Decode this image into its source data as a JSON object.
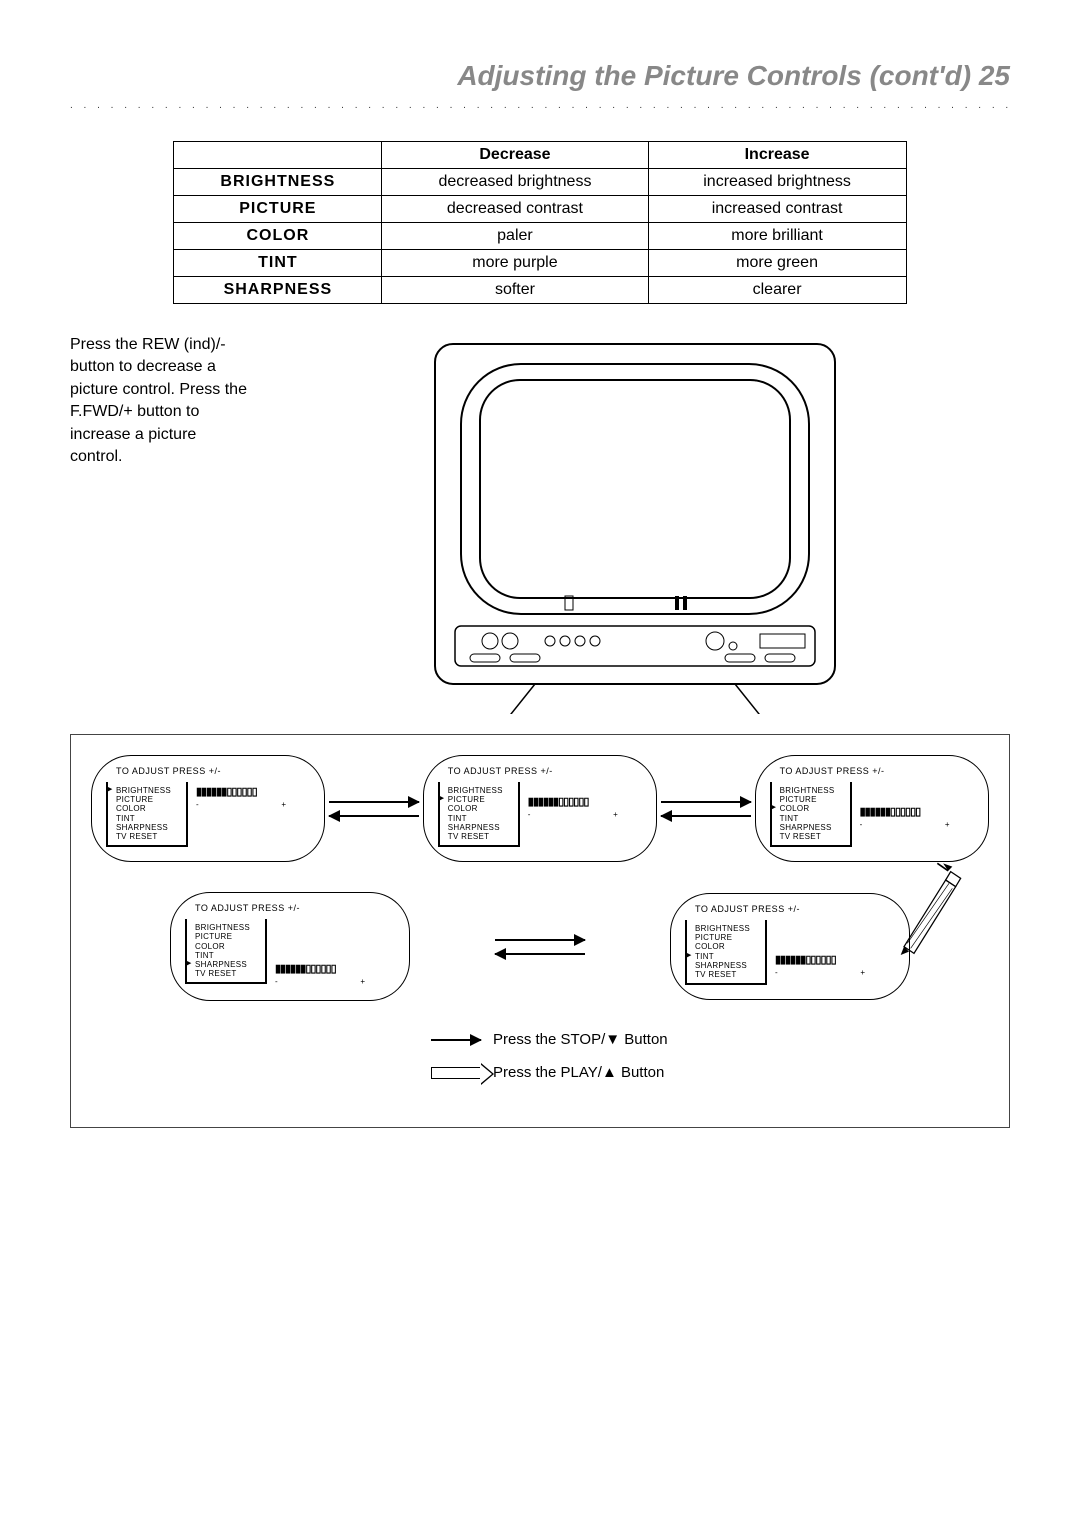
{
  "page": {
    "title": "Adjusting the Picture Controls (cont'd)  25"
  },
  "table": {
    "headers": {
      "col1": "",
      "col2": "Decrease",
      "col3": "Increase"
    },
    "rows": [
      {
        "label": "BRIGHTNESS",
        "dec": "decreased brightness",
        "inc": "increased brightness"
      },
      {
        "label": "PICTURE",
        "dec": "decreased contrast",
        "inc": "increased contrast"
      },
      {
        "label": "COLOR",
        "dec": "paler",
        "inc": "more brilliant"
      },
      {
        "label": "TINT",
        "dec": "more purple",
        "inc": "more green"
      },
      {
        "label": "SHARPNESS",
        "dec": "softer",
        "inc": "clearer"
      }
    ]
  },
  "instruction": "Press the REW (ind)/- button to decrease a picture control. Press the F.FWD/+ button to increase a picture control.",
  "osd": {
    "title": "TO ADJUST PRESS +/-",
    "items": [
      "BRIGHTNESS",
      "PICTURE",
      "COLOR",
      "TINT",
      "SHARPNESS",
      "TV RESET"
    ],
    "bar_filled": "▮▮▮▮▮▮",
    "bar_empty": "▯▯▯▯▯▯",
    "minus": "-",
    "plus": "+"
  },
  "osd_screens": [
    {
      "selected": 0,
      "bar_row": 0
    },
    {
      "selected": 1,
      "bar_row": 1
    },
    {
      "selected": 2,
      "bar_row": 2
    },
    {
      "selected": 4,
      "bar_row": 4
    },
    {
      "selected": 3,
      "bar_row": 3
    }
  ],
  "legend": {
    "stop": "Press the STOP/▼ Button",
    "play": "Press the PLAY/▲ Button"
  }
}
